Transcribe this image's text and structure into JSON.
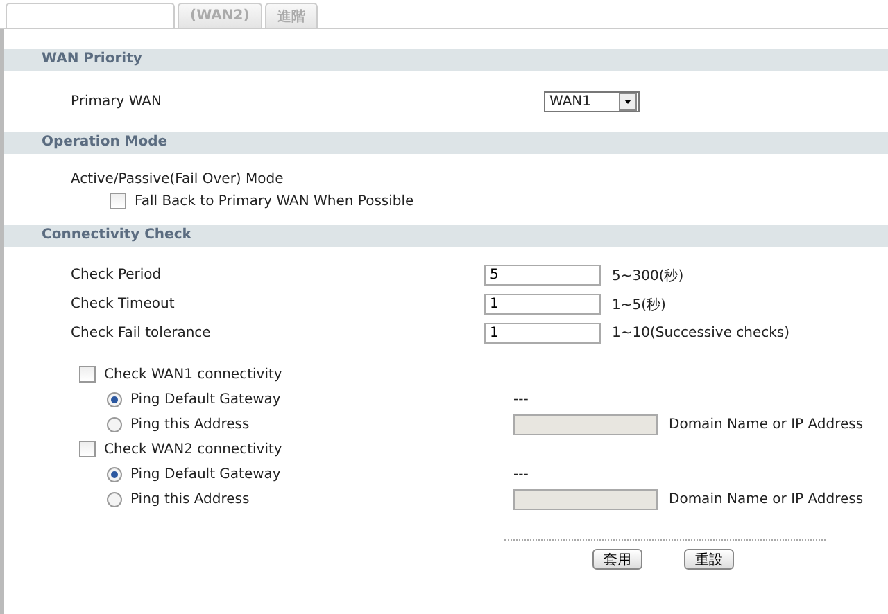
{
  "tabs": [
    {
      "selected": true
    },
    {
      "label": "(WAN2)",
      "selected": false
    },
    {
      "label": "進階",
      "selected": false
    }
  ],
  "wan_priority": {
    "title": "WAN Priority",
    "label": "Primary WAN",
    "value": "WAN1"
  },
  "operation_mode": {
    "title": "Operation Mode",
    "mode": "Active/Passive(Fail Over) Mode",
    "fallback": {
      "label": "Fall Back to Primary WAN When Possible",
      "checked": false
    }
  },
  "connectivity_check": {
    "title": "Connectivity Check",
    "fields": [
      {
        "label": "Check Period",
        "value": "5",
        "hint": "5~300(秒)"
      },
      {
        "label": "Check Timeout",
        "value": "1",
        "hint": "1~5(秒)"
      },
      {
        "label": "Check Fail tolerance",
        "value": "1",
        "hint": "1~10(Successive checks)"
      }
    ],
    "wans": [
      {
        "label": "Check WAN1 connectivity",
        "checked": false,
        "options": [
          {
            "label": "Ping Default Gateway",
            "selected": true,
            "value": "---"
          },
          {
            "label": "Ping this Address",
            "selected": false,
            "hint": "Domain Name or IP Address"
          }
        ]
      },
      {
        "label": "Check WAN2 connectivity",
        "checked": false,
        "options": [
          {
            "label": "Ping Default Gateway",
            "selected": true,
            "value": "---"
          },
          {
            "label": "Ping this Address",
            "selected": false,
            "hint": "Domain Name or IP Address"
          }
        ]
      }
    ]
  },
  "buttons": [
    "套用",
    "重設"
  ]
}
